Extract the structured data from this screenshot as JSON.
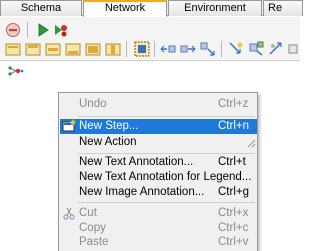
{
  "tabs": [
    {
      "label": "Schema"
    },
    {
      "label": "Network"
    },
    {
      "label": "Environment"
    },
    {
      "label": "Re"
    }
  ],
  "toolbar": {
    "icons": [
      "remove-icon",
      "run-icon",
      "run-debug-icon",
      "layout-icon",
      "align-top-icon",
      "align-middle-icon",
      "align-bottom-icon",
      "align-justify-icon",
      "select-icon",
      "connect-left-icon",
      "connect-right-icon",
      "connect-down-icon",
      "add-link-icon",
      "edit-link-icon",
      "auto-link-icon"
    ]
  },
  "context_menu": {
    "items": [
      {
        "label": "Undo",
        "shortcut": "Ctrl+z",
        "enabled": false
      },
      {
        "label": "New Step...",
        "shortcut": "Ctrl+n",
        "enabled": true,
        "highlighted": true,
        "icon": "new-step-icon"
      },
      {
        "label": "New Action",
        "shortcut": "",
        "enabled": true
      },
      {
        "label": "New Text Annotation...",
        "shortcut": "Ctrl+t",
        "enabled": true
      },
      {
        "label": "New Text Annotation for Legend...",
        "shortcut": "",
        "enabled": true
      },
      {
        "label": "New Image Annotation...",
        "shortcut": "Ctrl+g",
        "enabled": true
      },
      {
        "label": "Cut",
        "shortcut": "Ctrl+x",
        "enabled": false,
        "icon": "cut-icon"
      },
      {
        "label": "Copy",
        "shortcut": "Ctrl+c",
        "enabled": false
      },
      {
        "label": "Paste",
        "shortcut": "Ctrl+v",
        "enabled": false
      }
    ]
  }
}
